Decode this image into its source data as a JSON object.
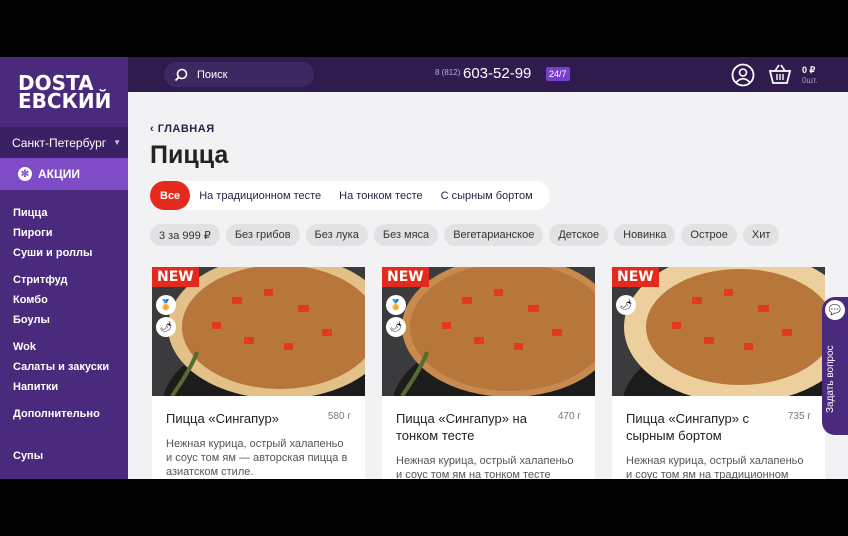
{
  "brand": {
    "logo_line1": "DOSTA",
    "logo_line2": "ЕВСКИЙ"
  },
  "sidebar": {
    "city": "Санкт-Петербург",
    "promo": "АКЦИИ",
    "groups": [
      [
        "Пицца",
        "Пироги",
        "Суши и роллы"
      ],
      [
        "Стритфуд",
        "Комбо",
        "Боулы"
      ],
      [
        "Wok",
        "Салаты и закуски",
        "Напитки"
      ],
      [
        "Дополнительно"
      ],
      [
        "Супы"
      ]
    ]
  },
  "topbar": {
    "search_placeholder": "Поиск",
    "phone_prefix": "8 (812)",
    "phone": "603-52-99",
    "hours": "24/7",
    "cart_sum": "0 ₽",
    "cart_count": "0шт."
  },
  "page": {
    "back": "ГЛАВНАЯ",
    "title": "Пицца"
  },
  "tabs": [
    "Все",
    "На традиционном тесте",
    "На тонком тесте",
    "С сырным бортом"
  ],
  "filters": [
    "3 за 999 ₽",
    "Без грибов",
    "Без лука",
    "Без мяса",
    "Вегетарианское",
    "Детское",
    "Новинка",
    "Острое",
    "Хит"
  ],
  "cards": [
    {
      "badge": "NEW",
      "name": "Пицца «Сингапур»",
      "weight": "580 г",
      "desc": "Нежная курица, острый халапеньо и соус том ям — авторская пицца в азиатском стиле."
    },
    {
      "badge": "NEW",
      "name": "Пицца «Сингапур» на тонком тесте",
      "weight": "470 г",
      "desc": "Нежная курица, острый халапеньо и соус том ям на тонком тесте"
    },
    {
      "badge": "NEW",
      "name": "Пицца «Сингапур» с сырным бортом",
      "weight": "735 г",
      "desc": "Нежная курица, острый халапеньо и соус том ям на традиционном"
    }
  ],
  "ask": "Задать вопрос",
  "colors": {
    "accent": "#e32a1c",
    "brand": "#4a2a7c",
    "topbar": "#2f1c4e"
  }
}
